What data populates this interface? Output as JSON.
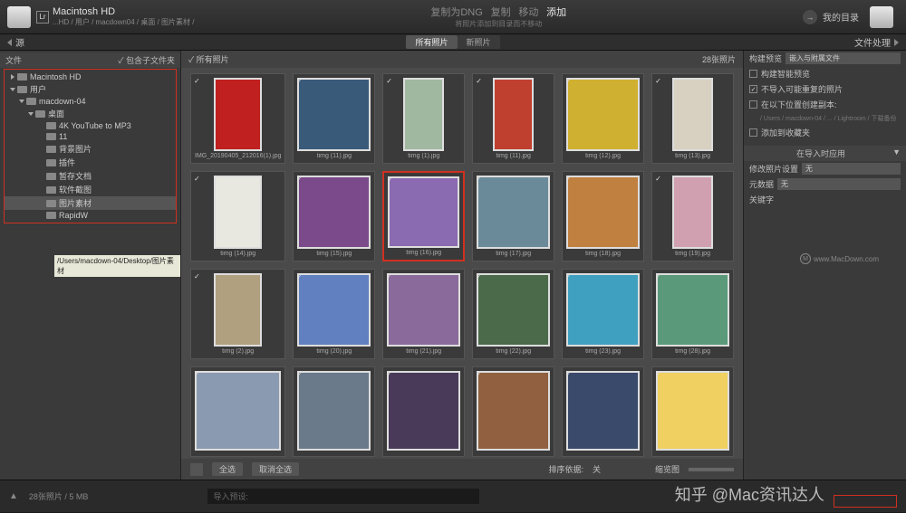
{
  "topbar": {
    "drive_title": "Macintosh HD",
    "breadcrumb": "...HD / 用户 / macdown04 / 桌面 / 图片素材 /",
    "actions": {
      "copy_dng": "复制为DNG",
      "copy": "复制",
      "move": "移动",
      "add": "添加"
    },
    "subline": "将照片添加到目录而不移动",
    "my_catalog": "我的目录"
  },
  "tabs": {
    "left_label": "源",
    "all_photos": "所有照片",
    "new_photos": "新照片",
    "right_label": "文件处理"
  },
  "left_panel": {
    "files": "文件",
    "include_sub": "包含子文件夹",
    "tree": {
      "root": "Macintosh HD",
      "users": "用户",
      "user": "macdown-04",
      "desktop": "桌面",
      "items": [
        "4K YouTube to MP3",
        "11",
        "背景图片",
        "插件",
        "暂存文档",
        "软件截图",
        "图片素材",
        "RapidW"
      ],
      "sel_idx": 6
    },
    "tooltip": "/Users/macdown-04/Desktop/图片素材"
  },
  "center": {
    "header_checked": "所有照片",
    "header_count": "28张照片",
    "thumbs": [
      {
        "n": "IMG_20190405_212016(1).jpg",
        "p": true,
        "c": "#c02020"
      },
      {
        "n": "timg (11).jpg",
        "p": false,
        "c": "#3a5a7a"
      },
      {
        "n": "timg (1).jpg",
        "p": true,
        "c": "#a0b8a0"
      },
      {
        "n": "timg (11).jpg",
        "p": true,
        "c": "#c04030"
      },
      {
        "n": "timg (12).jpg",
        "p": false,
        "c": "#d0b030"
      },
      {
        "n": "timg (13).jpg",
        "p": true,
        "c": "#d8d0c0"
      },
      {
        "n": "timg (14).jpg",
        "p": true,
        "c": "#e8e8e0"
      },
      {
        "n": "timg (15).jpg",
        "p": false,
        "c": "#7a4a8a"
      },
      {
        "n": "timg (16).jpg",
        "p": false,
        "c": "#8a6ab0",
        "hl": true
      },
      {
        "n": "timg (17).jpg",
        "p": false,
        "c": "#6a8a9a"
      },
      {
        "n": "timg (18).jpg",
        "p": false,
        "c": "#c08040"
      },
      {
        "n": "timg (19).jpg",
        "p": true,
        "c": "#d0a0b0"
      },
      {
        "n": "timg (2).jpg",
        "p": true,
        "c": "#b0a080"
      },
      {
        "n": "timg (20).jpg",
        "p": false,
        "c": "#6080c0"
      },
      {
        "n": "timg (21).jpg",
        "p": false,
        "c": "#8a6a9a"
      },
      {
        "n": "timg (22).jpg",
        "p": false,
        "c": "#4a6a4a"
      },
      {
        "n": "timg (23).jpg",
        "p": false,
        "c": "#40a0c0"
      },
      {
        "n": "timg (28).jpg",
        "p": false,
        "c": "#5a9a7a"
      },
      {
        "n": "",
        "p": false,
        "c": "#8a9ab0"
      },
      {
        "n": "",
        "p": false,
        "c": "#6a7a8a"
      },
      {
        "n": "",
        "p": false,
        "c": "#4a3a5a"
      },
      {
        "n": "",
        "p": false,
        "c": "#906040"
      },
      {
        "n": "",
        "p": false,
        "c": "#3a4a6a"
      },
      {
        "n": "",
        "p": false,
        "c": "#f0d060"
      }
    ],
    "footer": {
      "select_all": "全选",
      "deselect_all": "取消全选",
      "sort_label": "排序依据:",
      "sort_value": "关",
      "thumb_view": "缩览图"
    }
  },
  "right_panel": {
    "build_preview": "构建预览",
    "build_preview_val": "嵌入与附属文件",
    "smart_preview": "构建智能预览",
    "no_dup": "不导入可能重复的照片",
    "backup_to": "在以下位置创建副本:",
    "backup_path": "/ Users / macdown-04 / ... / Lightroom / 下载备份",
    "add_collection": "添加到收藏夹",
    "apply_section": "在导入时应用",
    "dev_settings": "修改照片设置",
    "dev_val": "无",
    "metadata": "元数据",
    "meta_val": "无",
    "keywords": "关键字"
  },
  "bottom": {
    "info": "28张照片 / 5 MB",
    "input_placeholder": "导入预设:"
  },
  "watermark": "www.MacDown.com",
  "zhihu": "知乎 @Mac资讯达人"
}
